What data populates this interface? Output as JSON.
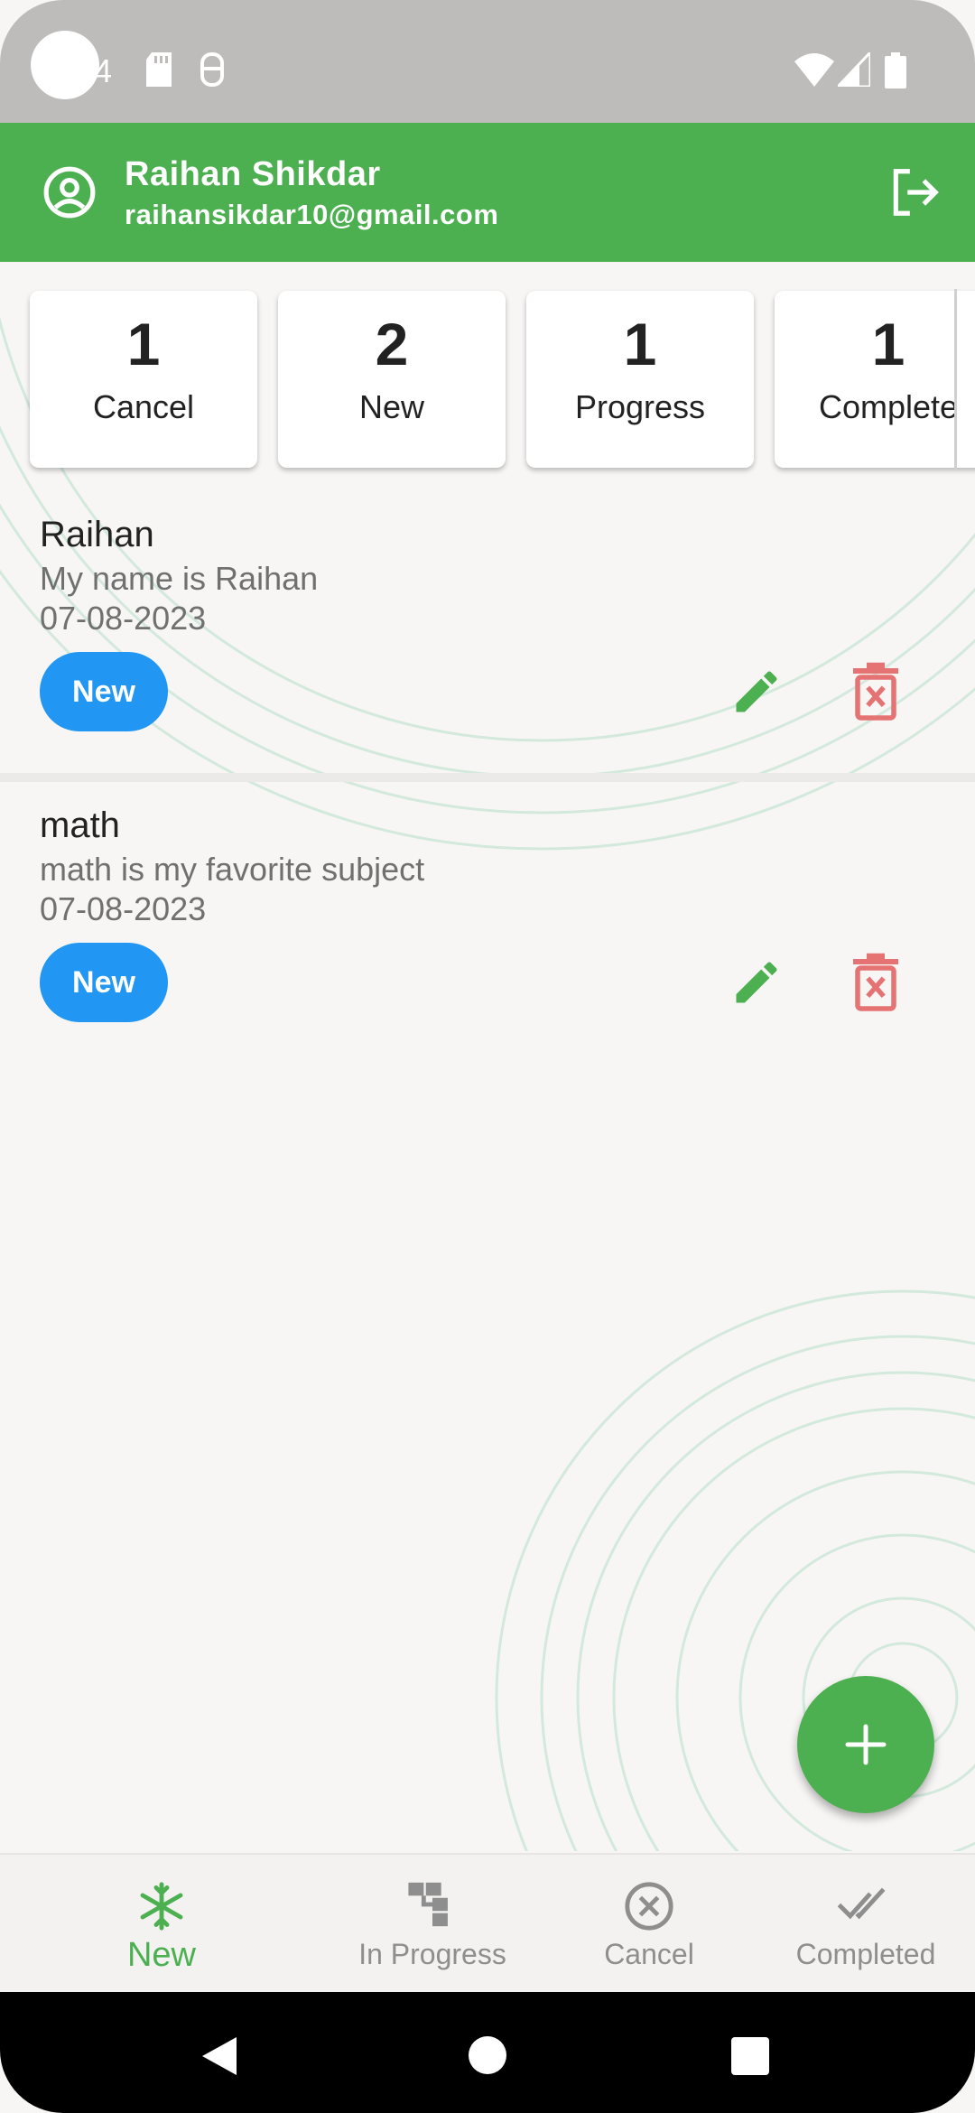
{
  "status_bar": {
    "time_fragment": "4"
  },
  "app_bar": {
    "user_name": "Raihan Shikdar",
    "user_email": "raihansikdar10@gmail.com"
  },
  "summary": [
    {
      "count": "1",
      "label": "Cancel"
    },
    {
      "count": "2",
      "label": "New"
    },
    {
      "count": "1",
      "label": "Progress"
    },
    {
      "count": "1",
      "label": "Complete"
    }
  ],
  "tasks": [
    {
      "title": "Raihan",
      "description": "My name is Raihan",
      "date": "07-08-2023",
      "status": "New"
    },
    {
      "title": "math",
      "description": "math is my favorite subject",
      "date": "07-08-2023",
      "status": "New"
    }
  ],
  "bottom_nav": {
    "items": [
      {
        "label": "New",
        "icon": "snowflake-icon",
        "active": true
      },
      {
        "label": "In Progress",
        "icon": "hierarchy-icon",
        "active": false
      },
      {
        "label": "Cancel",
        "icon": "cancel-circle-icon",
        "active": false
      },
      {
        "label": "Completed",
        "icon": "double-check-icon",
        "active": false
      }
    ]
  },
  "colors": {
    "primary": "#4caf50",
    "chip": "#2196f3",
    "delete": "#e57373",
    "muted": "#8e8e8e"
  }
}
